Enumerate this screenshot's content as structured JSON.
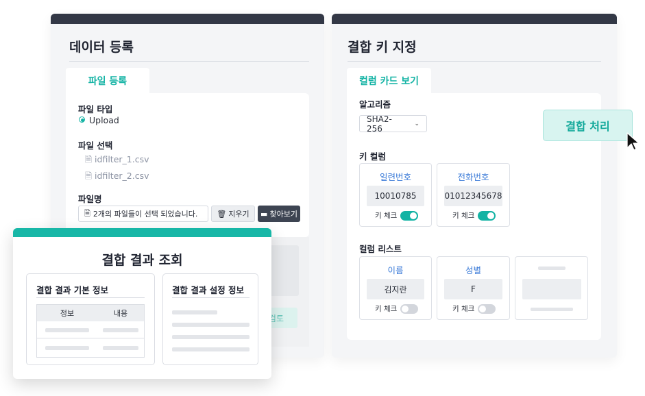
{
  "left_panel": {
    "title": "데이터 등록",
    "tab": "파일 등록",
    "file_type_label": "파일 타입",
    "file_type_option": "Upload",
    "file_select_label": "파일 선택",
    "files": [
      "idfilter_1.csv",
      "idfilter_2.csv"
    ],
    "filename_label": "파일명",
    "filename_value": "2개의 파일들이 선택 되었습니다.",
    "clear_label": "지우기",
    "browse_label": "찾아보기",
    "hidden_button_partial": "검토"
  },
  "right_panel": {
    "title": "결합 키 지정",
    "tab": "컬럼 카드 보기",
    "algorithm_label": "알고리즘",
    "algorithm_value": "SHA2-256",
    "process_button": "결합 처리",
    "key_column_label": "키 컬럼",
    "key_columns": [
      {
        "name": "일련번호",
        "value": "10010785",
        "check_label": "키 체크",
        "checked": true
      },
      {
        "name": "전화번호",
        "value": "01012345678",
        "check_label": "키 체크",
        "checked": true
      }
    ],
    "column_list_label": "컬럼 리스트",
    "column_list": [
      {
        "name": "이름",
        "value": "김지란",
        "check_label": "키 체크",
        "checked": false
      },
      {
        "name": "성별",
        "value": "F",
        "check_label": "키 체크",
        "checked": false
      }
    ]
  },
  "modal": {
    "title": "결합 결과 조회",
    "basic_info_title": "결합 결과 기본 정보",
    "table_headers": [
      "정보",
      "내용"
    ],
    "settings_info_title": "결합 결과 설정 정보"
  },
  "colors": {
    "accent": "#13b3a4",
    "panel_header": "#333846",
    "modal_header": "#18b7a7",
    "column_name": "#3b7bd8"
  }
}
